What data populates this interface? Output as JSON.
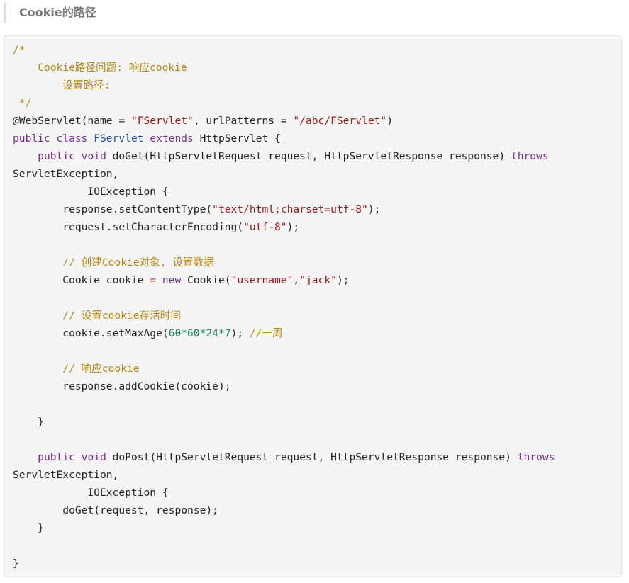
{
  "heading": "Cookie的路径",
  "colors": {
    "comment": "#b8860b",
    "keyword": "#7a2f8c",
    "type": "#1f4fa8",
    "string": "#a31515",
    "number": "#098658",
    "background": "#f5f5f5"
  },
  "code": {
    "l1": "/*",
    "l2": "    Cookie路径问题: 响应cookie",
    "l3": "        设置路径:",
    "l4": " */",
    "l5": {
      "a": "@WebServlet(name = ",
      "b": "\"FServlet\"",
      "c": ", urlPatterns = ",
      "d": "\"/abc/FServlet\"",
      "e": ")"
    },
    "l6": {
      "a": "public class ",
      "b": "FServlet",
      "c": " extends ",
      "d": "HttpServlet",
      "e": " {"
    },
    "l7": {
      "indent": "    ",
      "a": "public void",
      "b": " doGet(HttpServletRequest request, HttpServletResponse response) ",
      "c": "throws"
    },
    "l8": "ServletException,",
    "l9": "            IOException {",
    "l10": {
      "a": "        response.setContentType(",
      "b": "\"text/html;charset=utf-8\"",
      "c": ");"
    },
    "l11": {
      "a": "        request.setCharacterEncoding(",
      "b": "\"utf-8\"",
      "c": ");"
    },
    "l12": "",
    "l13": "        // 创建Cookie对象, 设置数据",
    "l14": {
      "a": "        Cookie cookie ",
      "b": "=",
      "c": " ",
      "d": "new",
      "e": " Cookie(",
      "f": "\"username\"",
      "g": ",",
      "h": "\"jack\"",
      "i": ");"
    },
    "l15": "",
    "l16": "        // 设置cookie存活时间",
    "l17": {
      "a": "        cookie.setMaxAge(",
      "b": "60*60*24*7",
      "c": "); ",
      "d": "//一周"
    },
    "l18": "",
    "l19": "        // 响应cookie",
    "l20": "        response.addCookie(cookie);",
    "l21": "",
    "l22": "    }",
    "l23": "",
    "l24": {
      "indent": "    ",
      "a": "public void",
      "b": " doPost(HttpServletRequest request, HttpServletResponse response) ",
      "c": "throws"
    },
    "l25": "ServletException,",
    "l26": "            IOException {",
    "l27": "        doGet(request, response);",
    "l28": "    }",
    "l29": "",
    "l30": "}"
  }
}
